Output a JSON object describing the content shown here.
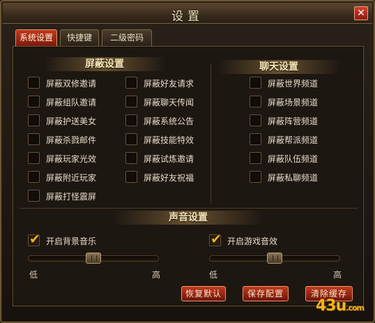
{
  "window": {
    "title": "设置",
    "close_label": "✕"
  },
  "tabs": [
    {
      "label": "系统设置",
      "active": true
    },
    {
      "label": "快捷键",
      "active": false
    },
    {
      "label": "二级密码",
      "active": false
    }
  ],
  "shield": {
    "title": "屏蔽设置",
    "col1": [
      "屏蔽双修邀请",
      "屏蔽组队邀请",
      "屏蔽护送美女",
      "屏蔽杀戮邮件",
      "屏蔽玩家光效",
      "屏蔽附近玩家",
      "屏蔽打怪震屏"
    ],
    "col2": [
      "屏蔽好友请求",
      "屏蔽聊天传闻",
      "屏蔽系统公告",
      "屏蔽技能特效",
      "屏蔽试炼邀请",
      "屏蔽好友祝福"
    ]
  },
  "chat": {
    "title": "聊天设置",
    "items": [
      "屏蔽世界频道",
      "屏蔽场景频道",
      "屏蔽阵营频道",
      "屏蔽帮派频道",
      "屏蔽队伍频道",
      "屏蔽私聊频道"
    ]
  },
  "sound": {
    "title": "声音设置",
    "bgm": {
      "label": "开启背景音乐",
      "checked": true,
      "level": 0.5
    },
    "sfx": {
      "label": "开启游戏音效",
      "checked": true,
      "level": 0.5
    },
    "low_label": "低",
    "high_label": "高"
  },
  "buttons": {
    "reset": "恢复默认",
    "save": "保存配置",
    "clear": "清除缓存"
  },
  "logo": {
    "main": "43",
    "u": "u",
    "suffix": ".com"
  },
  "colors": {
    "accent": "#c2391c",
    "gold": "#f0b422",
    "border": "#6b5532"
  }
}
